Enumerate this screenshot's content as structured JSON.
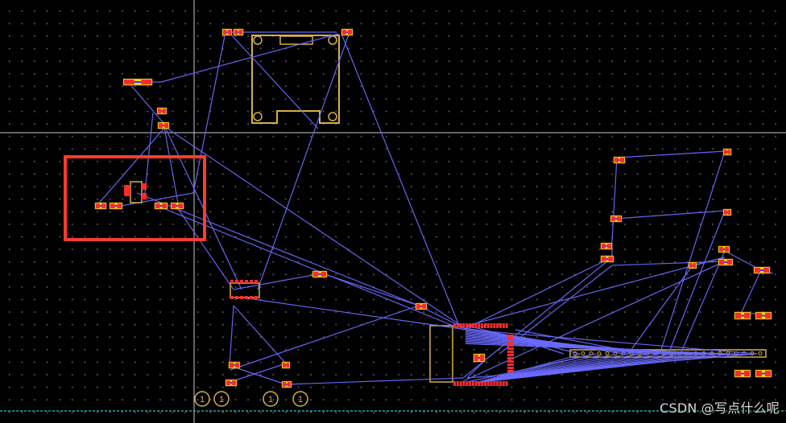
{
  "watermark": "CSDN @写点什么呢",
  "designator_text": "1",
  "colors": {
    "background": "#000000",
    "grid_dot": "#5a5a5a",
    "crosshair": "#c8c8c8",
    "ratsnest": "#6a6aff",
    "pad": "#ff2a2a",
    "silkscreen": "#d4b14a",
    "selection": "#ff3b30",
    "board_edge": "#2ec9c9"
  },
  "icons": {
    "component": "smd-component-icon",
    "mounting_hole": "mounting-hole-icon",
    "test_point": "test-point-icon"
  }
}
